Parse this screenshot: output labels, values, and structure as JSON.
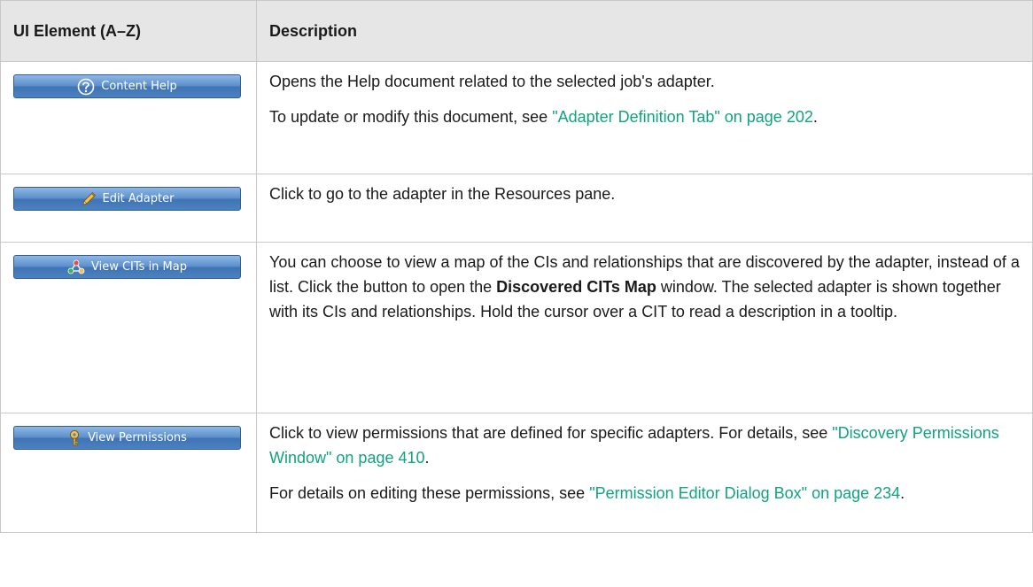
{
  "header": {
    "col_element": "UI Element (A–Z)",
    "col_description": "Description"
  },
  "rows": [
    {
      "button_label": "Content Help",
      "icon": "help-question-icon",
      "p1": "Opens the Help document related to the selected job's adapter.",
      "p2_pre": "To update or modify this document, see ",
      "p2_link": "\"Adapter Definition Tab\" on page 202",
      "p2_post": "."
    },
    {
      "button_label": "Edit Adapter",
      "icon": "pencil-icon",
      "p1": "Click to go to the adapter in the Resources pane."
    },
    {
      "button_label": "View CITs in Map",
      "icon": "ci-map-icon",
      "p1_pre": "You can choose to view a map of the CIs and relationships that are discovered by the adapter, instead of a list. Click the button to open the ",
      "p1_bold": "Discovered CITs Map",
      "p1_post": " window. The selected adapter is shown together with its CIs and relationships. Hold the cursor over a CIT to read a description in a tooltip."
    },
    {
      "button_label": "View Permissions",
      "icon": "key-icon",
      "p1_pre": "Click to view permissions that are defined for specific adapters. For details, see ",
      "p1_link": "\"Discovery Permissions Window\" on page 410",
      "p1_post": ".",
      "p2_pre": "For details on editing these permissions, see ",
      "p2_link": "\"Permission Editor Dialog Box\" on page 234",
      "p2_post": "."
    }
  ],
  "colors": {
    "link": "#10a37f",
    "header_bg": "#e6e6e6",
    "button_blue": "#4d82c2"
  }
}
